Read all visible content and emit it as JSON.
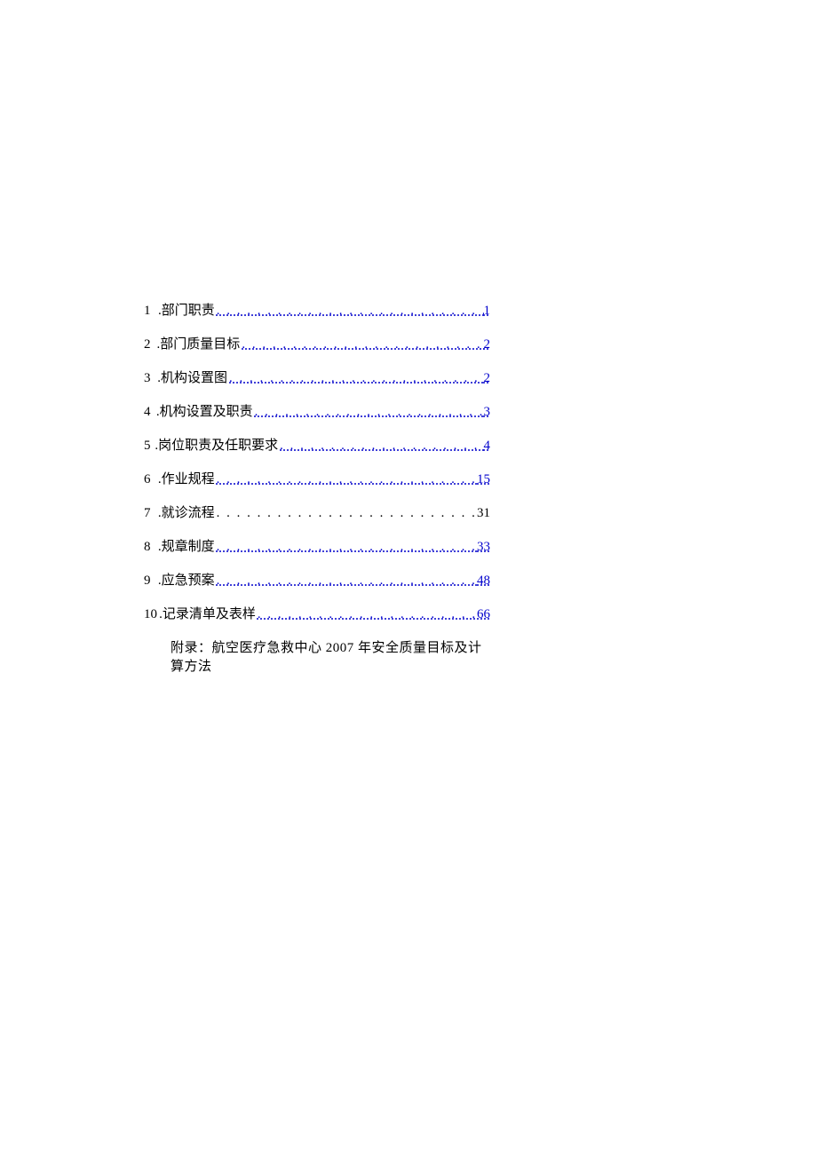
{
  "toc": {
    "leader": ". . . . . . . . . . . . . . . . . . . . . . . . . . . . . . . . . . . . . . . . . . . . . . . . . .",
    "items": [
      {
        "num": "1",
        "title": ".部门职责",
        "page": "1",
        "link": true
      },
      {
        "num": "2",
        "title": ".部门质量目标",
        "page": "2",
        "link": true
      },
      {
        "num": "3",
        "title": ".机构设置图",
        "page": "2",
        "link": true
      },
      {
        "num": "4",
        "title": ".机构设置及职责",
        "page": "3",
        "link": true
      },
      {
        "num": "5",
        "title": ".岗位职责及任职要求",
        "page": "4",
        "link": true
      },
      {
        "num": "6",
        "title": ".作业规程",
        "page": "15",
        "link": true
      },
      {
        "num": "7",
        "title": ".就诊流程",
        "page": "31",
        "link": false
      },
      {
        "num": "8",
        "title": ".规章制度",
        "page": "33",
        "link": true
      },
      {
        "num": "9",
        "title": ".应急预案",
        "page": "48",
        "link": true
      },
      {
        "num": "10",
        "title": ".记录清单及表样",
        "page": "66",
        "link": true
      }
    ],
    "appendix": "附录：航空医疗急救中心 2007 年安全质量目标及计算方法"
  }
}
